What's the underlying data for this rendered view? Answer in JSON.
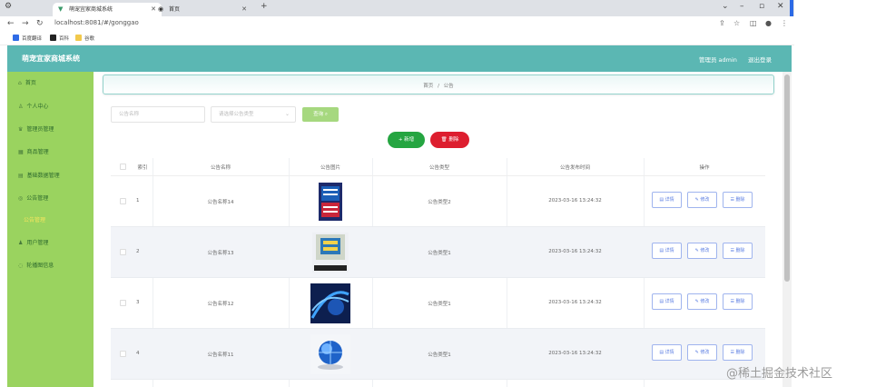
{
  "browser": {
    "tabs": [
      {
        "title": "萌宠宜家商城系统"
      },
      {
        "title": "首页"
      }
    ],
    "url": "localhost:8081/#/gonggao",
    "bookmarks": [
      "百度翻译",
      "百科",
      "谷歌"
    ]
  },
  "header": {
    "app_title": "萌宠宜家商城系统",
    "user_label": "管理员 admin",
    "logout": "退出登录"
  },
  "sidebar": {
    "items": [
      {
        "label": "首页"
      },
      {
        "label": "个人中心"
      },
      {
        "label": "管理员管理"
      },
      {
        "label": "商品管理"
      },
      {
        "label": "基础数据管理"
      },
      {
        "label": "公告管理"
      },
      {
        "label": "公告管理"
      },
      {
        "label": "用户管理"
      },
      {
        "label": "轮播图信息"
      }
    ]
  },
  "breadcrumb": {
    "home": "首页",
    "sep": "/",
    "current": "公告"
  },
  "search": {
    "name_placeholder": "公告名称",
    "type_placeholder": "请选择公告类型",
    "button": "查询"
  },
  "actions": {
    "add": "新增",
    "delete": "删除"
  },
  "table": {
    "headers": [
      "索引",
      "公告名称",
      "公告图片",
      "公告类型",
      "公告发布时间",
      "操作"
    ],
    "rows": [
      {
        "index": "1",
        "name": "公告名称14",
        "type": "公告类型2",
        "time": "2023-03-16 13:24:32"
      },
      {
        "index": "2",
        "name": "公告名称13",
        "type": "公告类型1",
        "time": "2023-03-16 13:24:32"
      },
      {
        "index": "3",
        "name": "公告名称12",
        "type": "公告类型1",
        "time": "2023-03-16 13:24:32"
      },
      {
        "index": "4",
        "name": "公告名称11",
        "type": "公告类型1",
        "time": "2023-03-16 13:24:32"
      }
    ],
    "ops": {
      "detail": "详情",
      "edit": "修改",
      "delete": "删除"
    }
  },
  "watermark": "@稀土掘金技术社区"
}
